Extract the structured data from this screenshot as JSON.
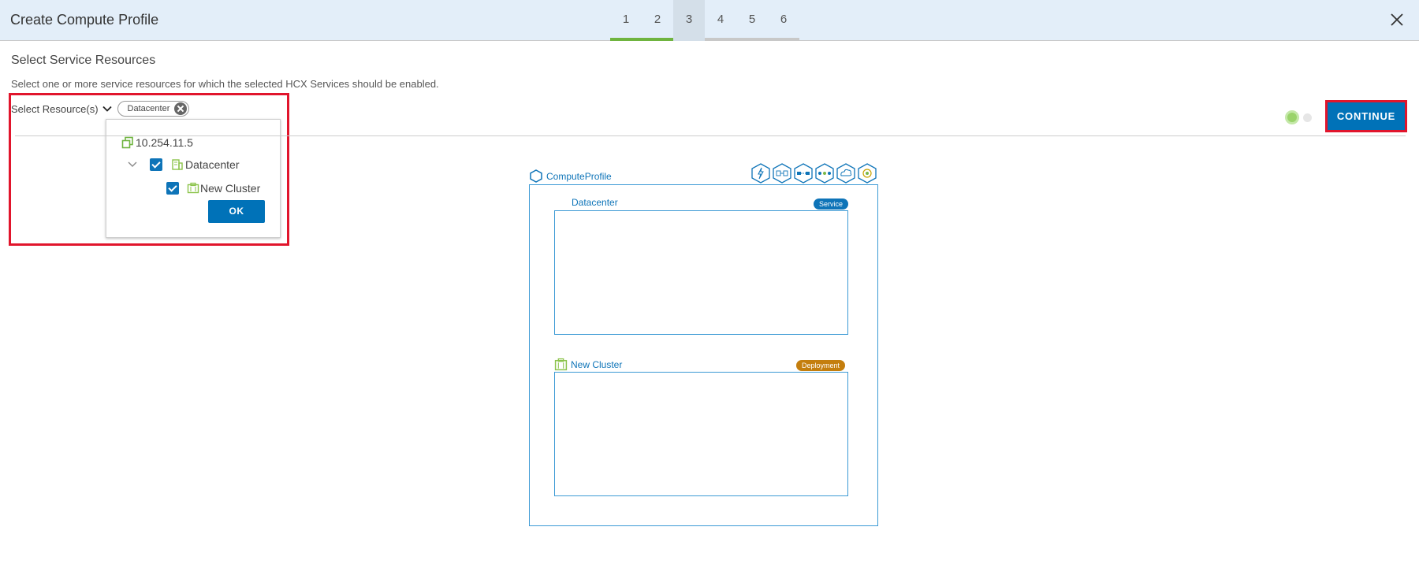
{
  "header": {
    "title": "Create Compute Profile",
    "steps": [
      "1",
      "2",
      "3",
      "4",
      "5",
      "6"
    ]
  },
  "section": {
    "title": "Select Service Resources",
    "description": "Select one or more service resources for which the selected HCX Services should be enabled."
  },
  "selector": {
    "label": "Select Resource(s)",
    "chip": "Datacenter"
  },
  "dropdown": {
    "root": "10.254.11.5",
    "datacenter": "Datacenter",
    "cluster": "New Cluster",
    "ok_label": "OK"
  },
  "actions": {
    "continue_label": "CONTINUE"
  },
  "diagram": {
    "profile_name": "ComputeProfile",
    "service_icons": [
      "hcx-interconnect-icon",
      "wan-optimization-icon",
      "network-extension-icon",
      "bulk-migration-icon",
      "cloud-vmotion-icon",
      "disaster-recovery-icon"
    ],
    "datacenter_label": "Datacenter",
    "datacenter_badge": "Service",
    "cluster_label": "New Cluster",
    "cluster_badge": "Deployment"
  },
  "colors": {
    "accent": "#0072b8",
    "highlight": "#e1152c",
    "step_done": "#6fb43f",
    "badge_service": "#0e74b8",
    "badge_deployment": "#c47e0d"
  }
}
